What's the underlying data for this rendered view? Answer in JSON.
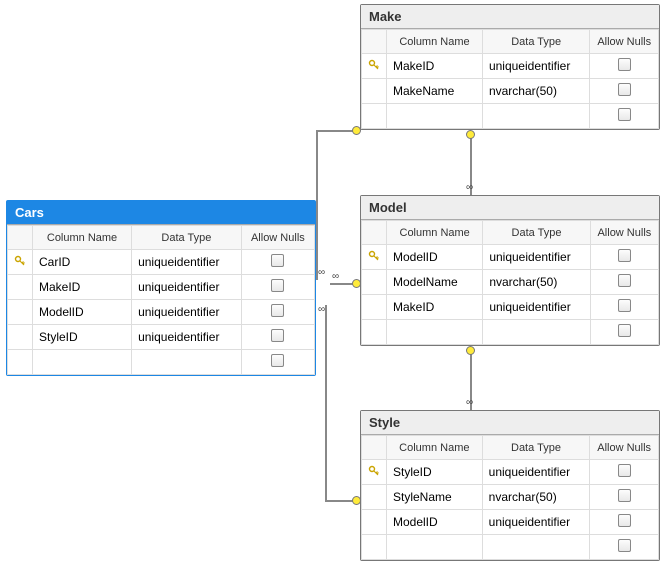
{
  "tables": {
    "make": {
      "title": "Make",
      "headers": {
        "col": "Column Name",
        "type": "Data Type",
        "nulls": "Allow Nulls"
      },
      "rows": [
        {
          "key": true,
          "name": "MakeID",
          "type": "uniqueidentifier"
        },
        {
          "key": false,
          "name": "MakeName",
          "type": "nvarchar(50)"
        },
        {
          "key": false,
          "name": "",
          "type": ""
        }
      ]
    },
    "model": {
      "title": "Model",
      "headers": {
        "col": "Column Name",
        "type": "Data Type",
        "nulls": "Allow Nulls"
      },
      "rows": [
        {
          "key": true,
          "name": "ModelID",
          "type": "uniqueidentifier"
        },
        {
          "key": false,
          "name": "ModelName",
          "type": "nvarchar(50)"
        },
        {
          "key": false,
          "name": "MakeID",
          "type": "uniqueidentifier"
        },
        {
          "key": false,
          "name": "",
          "type": ""
        }
      ]
    },
    "style": {
      "title": "Style",
      "headers": {
        "col": "Column Name",
        "type": "Data Type",
        "nulls": "Allow Nulls"
      },
      "rows": [
        {
          "key": true,
          "name": "StyleID",
          "type": "uniqueidentifier"
        },
        {
          "key": false,
          "name": "StyleName",
          "type": "nvarchar(50)"
        },
        {
          "key": false,
          "name": "ModelID",
          "type": "uniqueidentifier"
        },
        {
          "key": false,
          "name": "",
          "type": ""
        }
      ]
    },
    "cars": {
      "title": "Cars",
      "headers": {
        "col": "Column Name",
        "type": "Data Type",
        "nulls": "Allow Nulls"
      },
      "rows": [
        {
          "key": true,
          "name": "CarID",
          "type": "uniqueidentifier"
        },
        {
          "key": false,
          "name": "MakeID",
          "type": "uniqueidentifier"
        },
        {
          "key": false,
          "name": "ModelID",
          "type": "uniqueidentifier"
        },
        {
          "key": false,
          "name": "StyleID",
          "type": "uniqueidentifier"
        },
        {
          "key": false,
          "name": "",
          "type": ""
        }
      ]
    }
  },
  "relationships": [
    {
      "from": "Cars.MakeID",
      "to": "Make.MakeID"
    },
    {
      "from": "Cars.ModelID",
      "to": "Model.ModelID"
    },
    {
      "from": "Cars.StyleID",
      "to": "Style.StyleID"
    },
    {
      "from": "Model.MakeID",
      "to": "Make.MakeID"
    },
    {
      "from": "Style.ModelID",
      "to": "Model.ModelID"
    }
  ]
}
